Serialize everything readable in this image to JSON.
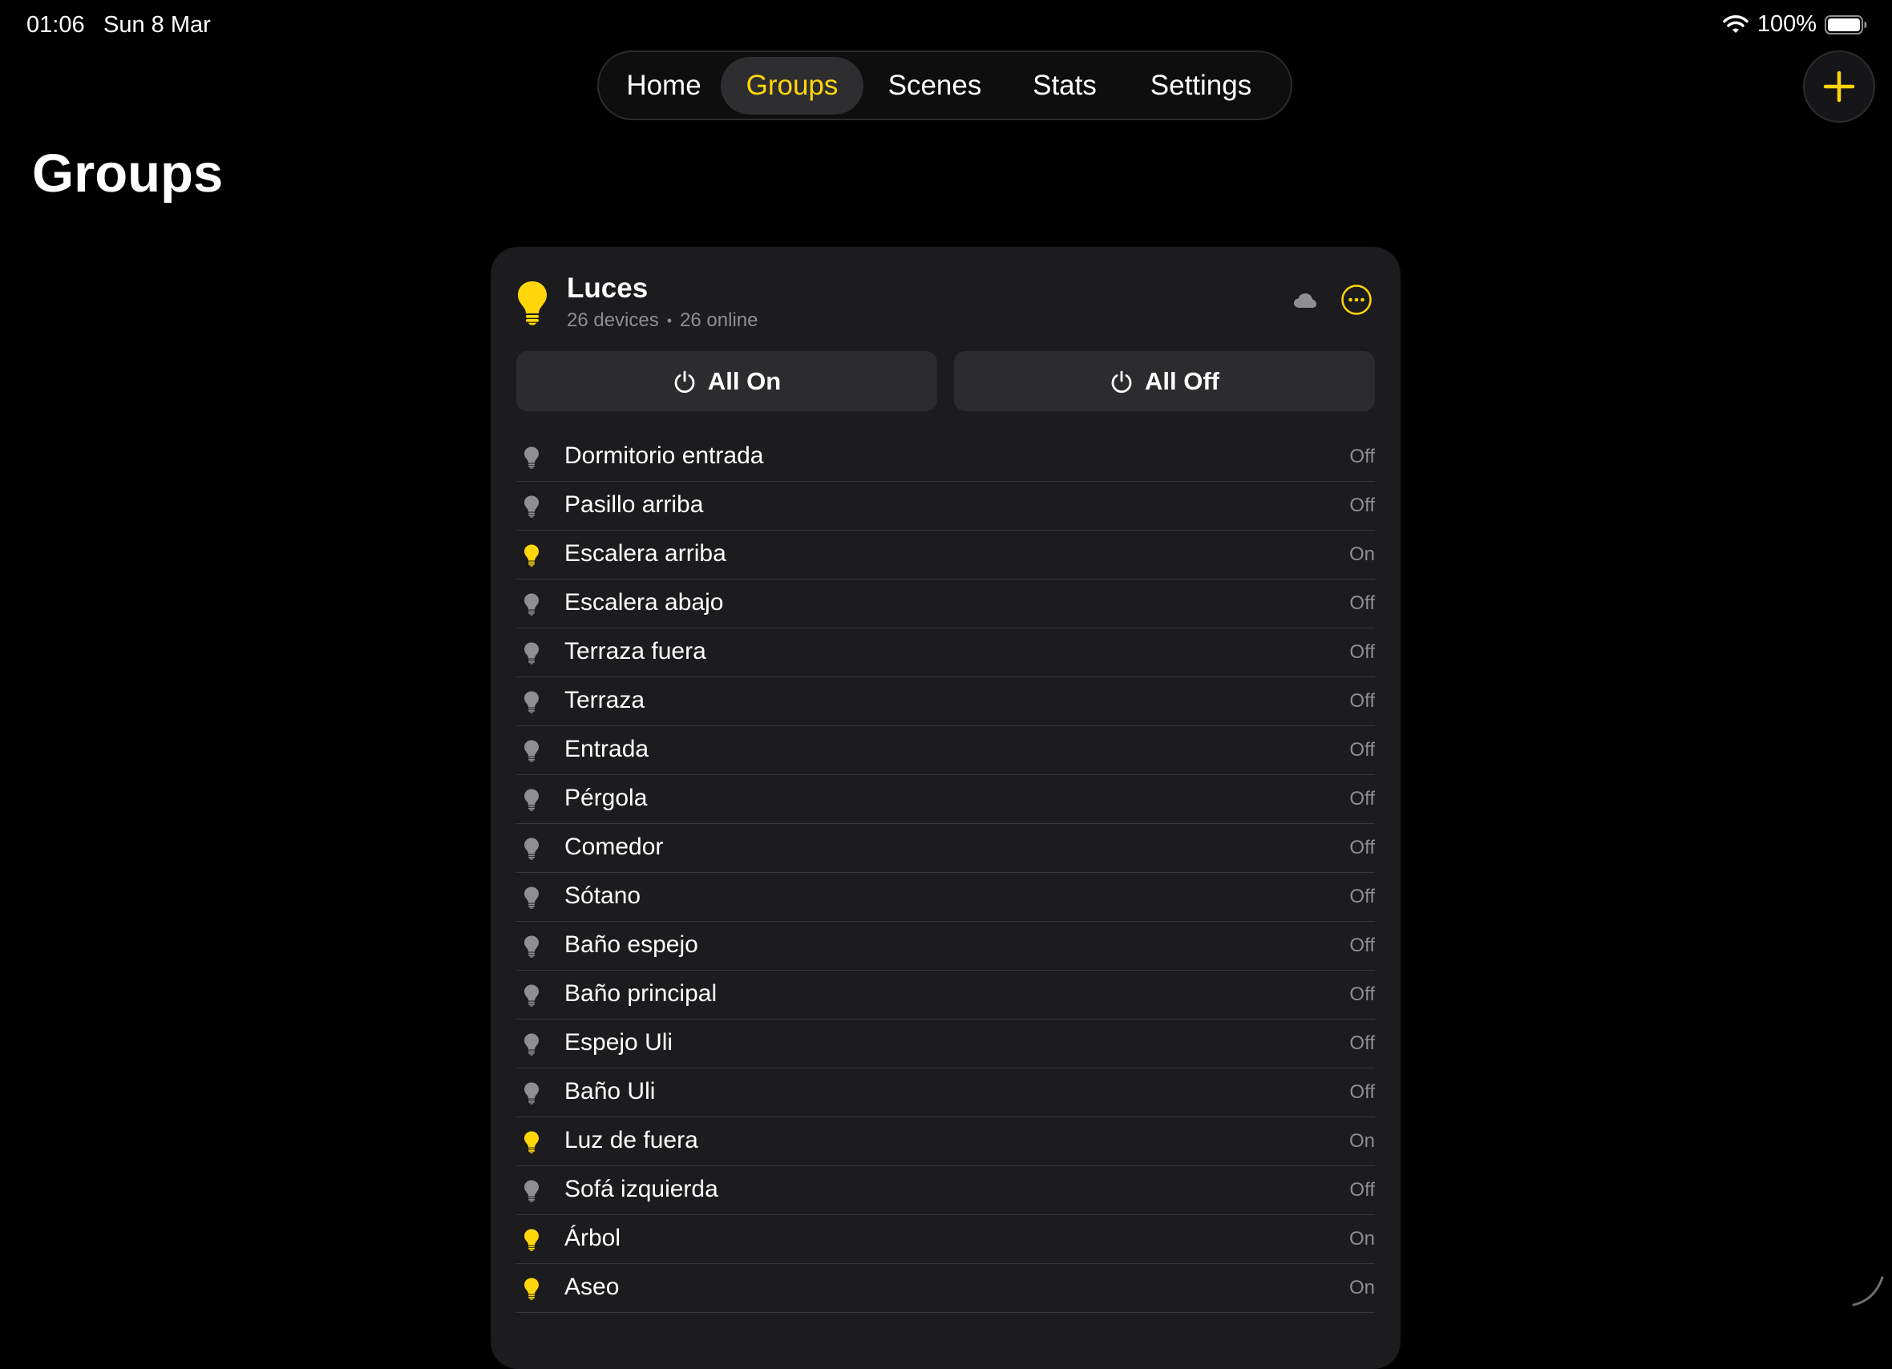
{
  "status_bar": {
    "time": "01:06",
    "date": "Sun 8 Mar",
    "battery": "100%"
  },
  "tabs": [
    {
      "label": "Home",
      "active": false
    },
    {
      "label": "Groups",
      "active": true
    },
    {
      "label": "Scenes",
      "active": false
    },
    {
      "label": "Stats",
      "active": false
    },
    {
      "label": "Settings",
      "active": false
    }
  ],
  "page_title": "Groups",
  "group": {
    "name": "Luces",
    "devices_count": "26 devices",
    "separator": "•",
    "online_count": "26 online",
    "all_on_label": "All On",
    "all_off_label": "All Off",
    "icon": "lightbulb-icon",
    "accent_color": "#ffd60a",
    "devices": [
      {
        "name": "Dormitorio entrada",
        "state": "Off",
        "on": false
      },
      {
        "name": "Pasillo arriba",
        "state": "Off",
        "on": false
      },
      {
        "name": "Escalera arriba",
        "state": "On",
        "on": true
      },
      {
        "name": "Escalera abajo",
        "state": "Off",
        "on": false
      },
      {
        "name": "Terraza fuera",
        "state": "Off",
        "on": false
      },
      {
        "name": "Terraza",
        "state": "Off",
        "on": false
      },
      {
        "name": "Entrada",
        "state": "Off",
        "on": false
      },
      {
        "name": "Pérgola",
        "state": "Off",
        "on": false
      },
      {
        "name": "Comedor",
        "state": "Off",
        "on": false
      },
      {
        "name": "Sótano",
        "state": "Off",
        "on": false
      },
      {
        "name": "Baño espejo",
        "state": "Off",
        "on": false
      },
      {
        "name": "Baño principal",
        "state": "Off",
        "on": false
      },
      {
        "name": "Espejo Uli",
        "state": "Off",
        "on": false
      },
      {
        "name": "Baño Uli",
        "state": "Off",
        "on": false
      },
      {
        "name": "Luz de fuera",
        "state": "On",
        "on": true
      },
      {
        "name": "Sofá izquierda",
        "state": "Off",
        "on": false
      },
      {
        "name": "Árbol",
        "state": "On",
        "on": true
      },
      {
        "name": "Aseo",
        "state": "On",
        "on": true
      }
    ]
  },
  "colors": {
    "accent": "#ffd60a",
    "off_bulb": "#8e8e93",
    "card_bg": "#1c1c1e",
    "button_bg": "#2c2c2e"
  }
}
